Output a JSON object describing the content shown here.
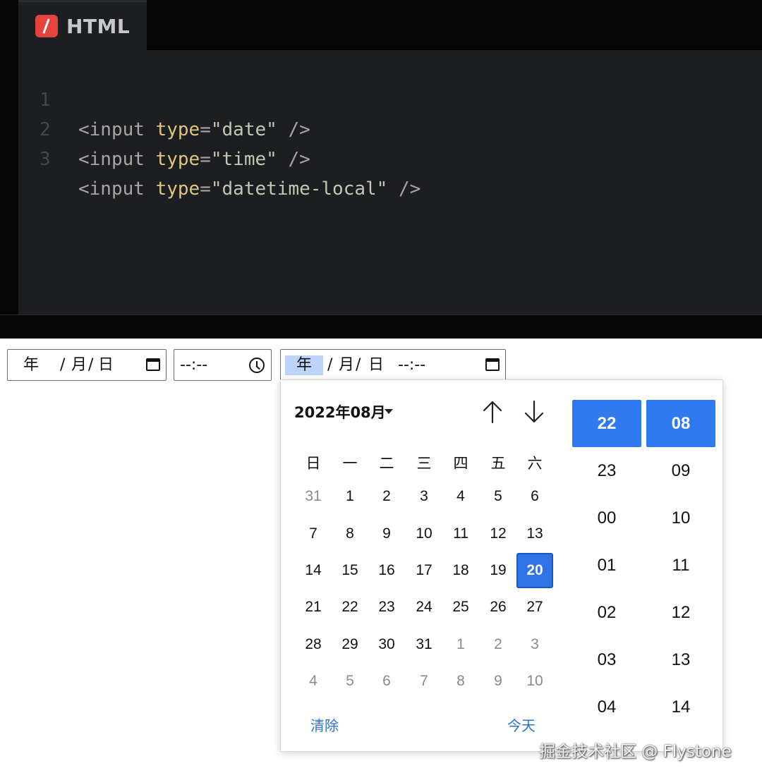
{
  "editor": {
    "tab_label": "HTML",
    "lines": [
      {
        "num": "1",
        "tag_open": "<",
        "element": "input",
        "attr": "type",
        "eq": "=",
        "value": "\"date\"",
        "tag_close": " />"
      },
      {
        "num": "2",
        "tag_open": "<",
        "element": "input",
        "attr": "type",
        "eq": "=",
        "value": "\"time\"",
        "tag_close": " />"
      },
      {
        "num": "3",
        "tag_open": "<",
        "element": "input",
        "attr": "type",
        "eq": "=",
        "value": "\"datetime-local\"",
        "tag_close": " />"
      }
    ]
  },
  "inputs": {
    "date": {
      "year": "年",
      "sep1": "/",
      "month": "月",
      "sep2": "/",
      "day": "日"
    },
    "time": {
      "value": "--:--"
    },
    "datetime": {
      "year": "年",
      "sep1": "/",
      "month": "月",
      "sep2": "/",
      "day": "日",
      "time": "--:--"
    }
  },
  "picker": {
    "month_label": "2022年08月",
    "weekdays": [
      "日",
      "一",
      "二",
      "三",
      "四",
      "五",
      "六"
    ],
    "weeks": [
      [
        "31",
        "1",
        "2",
        "3",
        "4",
        "5",
        "6"
      ],
      [
        "7",
        "8",
        "9",
        "10",
        "11",
        "12",
        "13"
      ],
      [
        "14",
        "15",
        "16",
        "17",
        "18",
        "19",
        "20"
      ],
      [
        "21",
        "22",
        "23",
        "24",
        "25",
        "26",
        "27"
      ],
      [
        "28",
        "29",
        "30",
        "31",
        "1",
        "2",
        "3"
      ],
      [
        "4",
        "5",
        "6",
        "7",
        "8",
        "9",
        "10"
      ]
    ],
    "selected_day": "20",
    "clear_label": "清除",
    "today_label": "今天",
    "hours": [
      "22",
      "23",
      "00",
      "01",
      "02",
      "03",
      "04"
    ],
    "minutes": [
      "08",
      "09",
      "10",
      "11",
      "12",
      "13",
      "14"
    ],
    "selected_hour": "22",
    "selected_minute": "08"
  },
  "colors": {
    "accent": "#2f74e5",
    "link": "#2a6fd3",
    "editor_bg": "#1d1e22",
    "tab_icon": "#e5433d"
  },
  "watermark": "掘金技术社区 @ Flystone"
}
